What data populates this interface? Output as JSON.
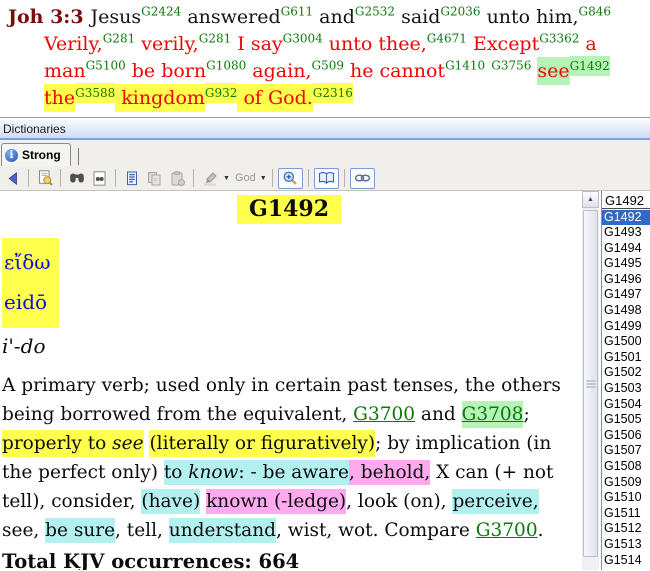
{
  "colors": {
    "selection_blue": "#316ac5",
    "verse_red": "#ef0505",
    "strongs_green": "#0a7a0a",
    "reference_maroon": "#7c0a0a",
    "highlight_yellow": "#ffff4d",
    "highlight_green": "#b7f3b7",
    "highlight_cyan": "#b3f0f0",
    "highlight_pink": "#ffaaee"
  },
  "verse_pane": {
    "reference": "Joh 3:3",
    "lines": [
      [
        {
          "t": "Jesus",
          "c": "k"
        },
        {
          "s": "G2424"
        },
        {
          "t": " answered",
          "c": "k"
        },
        {
          "s": "G611"
        },
        {
          "t": " and",
          "c": "k"
        },
        {
          "s": "G2532"
        },
        {
          "t": " said",
          "c": "k"
        },
        {
          "s": "G2036"
        },
        {
          "t": " unto him,",
          "c": "k"
        },
        {
          "s": "G846"
        }
      ],
      [
        {
          "t": "Verily,",
          "c": "r"
        },
        {
          "s": "G281"
        },
        {
          "t": " verily,",
          "c": "r"
        },
        {
          "s": "G281"
        },
        {
          "t": " I say",
          "c": "r"
        },
        {
          "s": "G3004"
        },
        {
          "t": " unto thee,",
          "c": "r"
        },
        {
          "s": "G4671"
        },
        {
          "t": " Except",
          "c": "r"
        },
        {
          "s": "G3362"
        },
        {
          "t": " a",
          "c": "r"
        }
      ],
      [
        {
          "t": "man",
          "c": "r"
        },
        {
          "s": "G5100"
        },
        {
          "t": " be born",
          "c": "r"
        },
        {
          "s": "G1080"
        },
        {
          "t": " again,",
          "c": "r"
        },
        {
          "s": "G509"
        },
        {
          "t": " he cannot",
          "c": "r"
        },
        {
          "s": "G1410"
        },
        {
          "t": " ",
          "c": "r"
        },
        {
          "s": "G3756"
        },
        {
          "t": " ",
          "c": "r"
        },
        {
          "t": "see",
          "c": "r",
          "h": "g"
        },
        {
          "s": "G1492",
          "h": "g"
        }
      ],
      [
        {
          "t": "the",
          "c": "r",
          "h": "y"
        },
        {
          "s": "G3588",
          "h": "y"
        },
        {
          "t": " kingdom",
          "c": "r",
          "h": "y"
        },
        {
          "s": "G932",
          "h": "y"
        },
        {
          "t": " of God.",
          "c": "r",
          "h": "y"
        },
        {
          "s": "G2316",
          "h": "y"
        }
      ]
    ]
  },
  "dictionaries": {
    "caption": "Dictionaries",
    "tab": "Strong",
    "toolbar": {
      "highlight_word": "God"
    }
  },
  "entry": {
    "number": "G1492",
    "greek": "εἴδω",
    "translit_latin": "eidō",
    "pronunciation": "i'-do",
    "definition_segments": [
      {
        "t": "A primary verb; used only in certain past tenses, the others being borrowed from the equivalent, "
      },
      {
        "t": "G3700",
        "l": 1
      },
      {
        "t": " and "
      },
      {
        "t": "G3708",
        "l": 1,
        "h": "g"
      },
      {
        "t": "; "
      },
      {
        "t": "properly to ",
        "h": "y"
      },
      {
        "t": "see",
        "h": "y",
        "i": 1
      },
      {
        "t": " "
      },
      {
        "t": "(literally or figuratively)",
        "h": "y"
      },
      {
        "t": "; by implication (in the perfect only) "
      },
      {
        "t": "to ",
        "h": "c"
      },
      {
        "t": "know",
        "h": "c",
        "i": 1
      },
      {
        "t": ": - be aware",
        "h": "c"
      },
      {
        "t": ", behold,",
        "h": "p"
      },
      {
        "t": " X can (+ not tell), consider, "
      },
      {
        "t": "(have)",
        "h": "c"
      },
      {
        "t": " "
      },
      {
        "t": "known (-ledge)",
        "h": "p"
      },
      {
        "t": ", look (on), "
      },
      {
        "t": "perceive,",
        "h": "c"
      },
      {
        "t": " see, "
      },
      {
        "t": "be sure",
        "h": "c"
      },
      {
        "t": ", tell, "
      },
      {
        "t": "understand",
        "h": "c"
      },
      {
        "t": ", wist, wot. Compare "
      },
      {
        "t": "G3700",
        "l": 1
      },
      {
        "t": "."
      }
    ],
    "total_line": "Total KJV occurrences: 664"
  },
  "right_panel": {
    "lookup_value": "G1492",
    "selected_index": 0,
    "items": [
      "G1492",
      "G1493",
      "G1494",
      "G1495",
      "G1496",
      "G1497",
      "G1498",
      "G1499",
      "G1500",
      "G1501",
      "G1502",
      "G1503",
      "G1504",
      "G1505",
      "G1506",
      "G1507",
      "G1508",
      "G1509",
      "G1510",
      "G1511",
      "G1512",
      "G1513",
      "G1514"
    ]
  }
}
